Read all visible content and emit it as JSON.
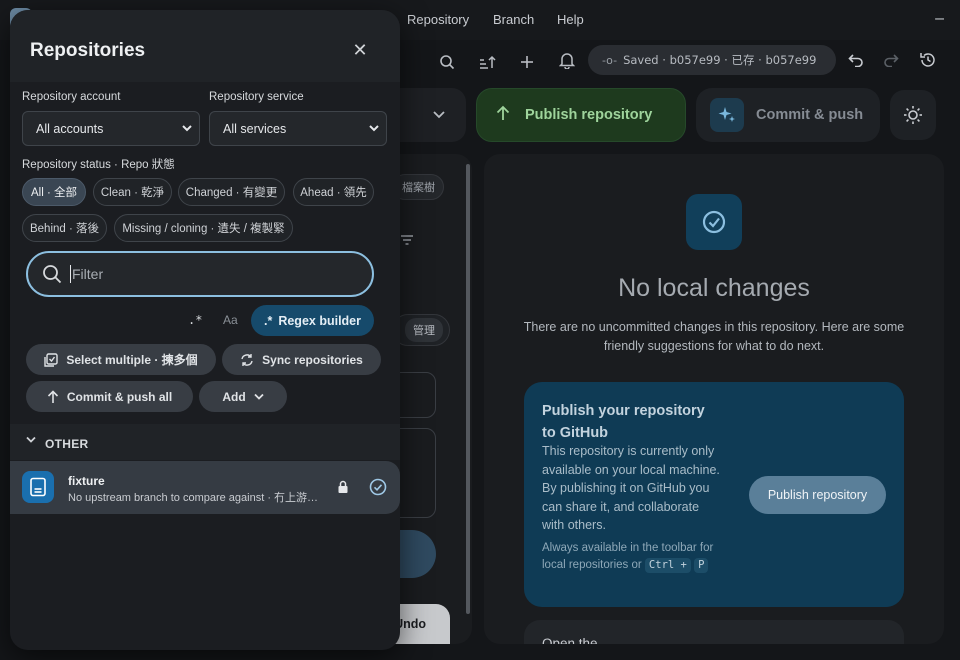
{
  "menubar": {
    "items": [
      "Repository",
      "Branch",
      "Help"
    ],
    "minimize_glyph": "–"
  },
  "toolbar": {
    "icons": [
      "search-icon",
      "sort-icon",
      "plus-icon",
      "bell-icon",
      "undo-icon",
      "redo-icon",
      "history-icon"
    ],
    "saved_text": "Saved · b057e99 · 已存 · b057e99"
  },
  "actions": {
    "publish_label": "Publish repository",
    "commit_label": "Commit & push"
  },
  "middle": {
    "tab_label": "檔案樹",
    "manage_label": "管理",
    "undo_label": "Undo"
  },
  "changes": {
    "title": "No local changes",
    "description": "There are no uncommitted changes in this repository. Here are some friendly suggestions for what to do next.",
    "publish_card": {
      "title": "Publish your repository to GitHub",
      "body": "This repository is currently only available on your local machine. By publishing it on GitHub you can share it, and collaborate with others.",
      "note": "Always available in the toolbar for local repositories or",
      "shortcut_1": "Ctrl +",
      "shortcut_2": "P",
      "button": "Publish repository"
    },
    "open_card_title": "Open the"
  },
  "modal": {
    "title": "Repositories",
    "close_glyph": "✕",
    "account_label": "Repository account",
    "account_value": "All accounts",
    "service_label": "Repository service",
    "service_value": "All services",
    "status_label": "Repository status · Repo 狀態",
    "status_chips": [
      "All · 全部",
      "Clean · 乾淨",
      "Changed · 有變更",
      "Ahead · 領先",
      "Behind · 落後",
      "Missing / cloning · 遺失 / 複製緊"
    ],
    "active_chip": "All · 全部",
    "filter_placeholder": "Filter",
    "regex_toggle": ".*",
    "case_toggle": "Aa",
    "regex_builder": "Regex builder",
    "regex_builder_glyph": ".*",
    "select_multiple": "Select multiple · 揀多個",
    "sync_repos": "Sync repositories",
    "commit_push_all": "Commit & push all",
    "add": "Add",
    "section_label": "OTHER",
    "repo": {
      "name": "fixture",
      "status": "No upstream branch to compare against · 冇上游分支可以比較"
    }
  },
  "colors": {
    "accent": "#8cbfe0",
    "publish_green": "#9fd49c",
    "card_blue": "#0f3b55"
  }
}
